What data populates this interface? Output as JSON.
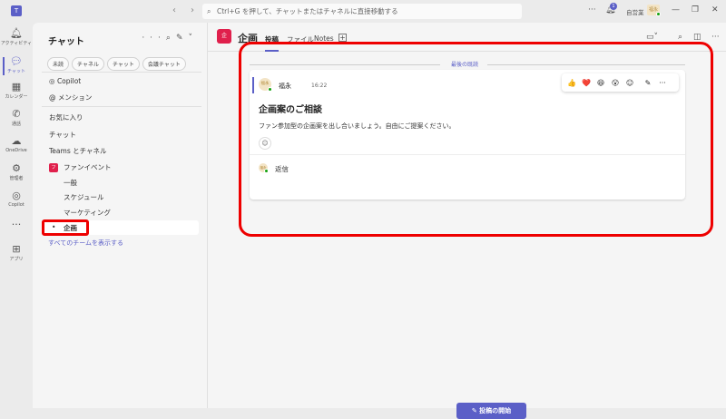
{
  "topbar": {
    "search_placeholder": "Ctrl+G を押して、チャットまたはチャネルに直接移動する",
    "notification_count": "1",
    "org": "自営業",
    "avatar": "福永",
    "more": "···",
    "minimize": "—",
    "restore": "❐",
    "close": "✕"
  },
  "rail": [
    {
      "label": "アクティビティ"
    },
    {
      "label": "チャット"
    },
    {
      "label": "カレンダー"
    },
    {
      "label": "通話"
    },
    {
      "label": "OneDrive"
    },
    {
      "label": "管理者"
    },
    {
      "label": "Copilot"
    },
    {
      "label": "···"
    },
    {
      "label": "アプリ"
    }
  ],
  "sidebar": {
    "title": "チャット",
    "filters": [
      "未読",
      "チャネル",
      "チャット",
      "会議チャット"
    ],
    "copilot": "Copilot",
    "mentions": "メンション",
    "favorites": "お気に入り",
    "chats": "チャット",
    "teams_header": "Teams とチャネル",
    "team": {
      "name": "ファンイベント",
      "icon": "フ"
    },
    "channels": [
      "一般",
      "スケジュール",
      "マーケティング",
      "企画"
    ],
    "show_all": "すべてのチームを表示する"
  },
  "channel": {
    "name": "企画",
    "icon": "企",
    "tabs": [
      "投稿",
      "ファイル",
      "Notes"
    ],
    "add_tab": "+"
  },
  "feed": {
    "last_read": "最後の既読",
    "post": {
      "author": "福永",
      "avatar": "福永",
      "time": "16:22",
      "subject": "企画案のご相談",
      "body": "ファン参加型の企画案を出し合いましょう。自由にご提案ください。",
      "reply": "返信"
    },
    "reactions": [
      "👍",
      "❤️",
      "😆",
      "😮",
      "☺",
      "✎",
      "···"
    ]
  },
  "composer": {
    "new_post": "投稿の開始"
  }
}
